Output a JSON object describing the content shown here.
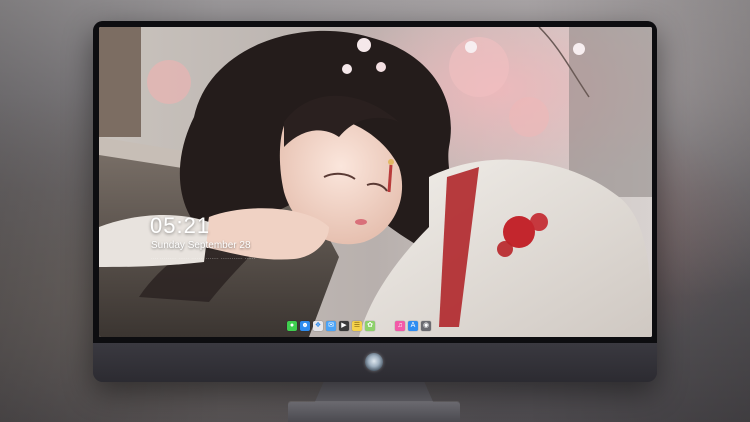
{
  "lock_screen": {
    "time": "05:21",
    "date": "Sunday September  28",
    "subline": "···· ········· ······ ······· ······· ············ ······"
  },
  "dock": {
    "apps": [
      {
        "icon": "messages-icon",
        "color": "#3fcf4f"
      },
      {
        "icon": "finder-icon",
        "color": "#2e8cf0"
      },
      {
        "icon": "safari-icon",
        "color": "#e6e6ea"
      },
      {
        "icon": "mail-icon",
        "color": "#4aa3f7"
      },
      {
        "icon": "claquette-icon",
        "color": "#3a3a3a"
      },
      {
        "icon": "notes-icon",
        "color": "#f6d24a"
      },
      {
        "icon": "photos-icon",
        "color": "#8ed16b"
      }
    ],
    "right_apps": [
      {
        "icon": "itunes-icon",
        "color": "#f25aa8"
      },
      {
        "icon": "app-store-icon",
        "color": "#2f8df2"
      },
      {
        "icon": "camera-icon",
        "color": "#6b6b70"
      }
    ]
  },
  "accent_colors": {
    "bezel": "#0d0d10",
    "chin": "#2f2f35"
  }
}
